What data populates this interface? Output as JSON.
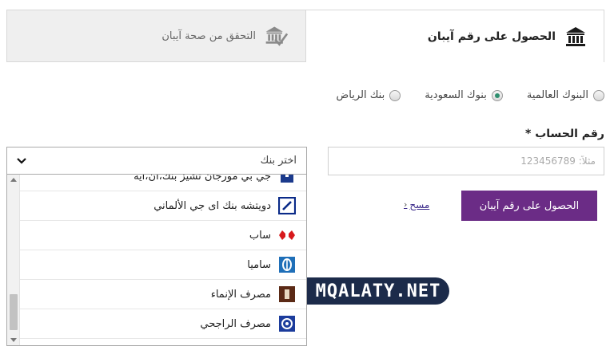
{
  "tabs": {
    "verify": {
      "label": "التحقق من صحة آيبان",
      "icon": "bank-check-icon"
    },
    "get": {
      "label": "الحصول على رقم آيبان",
      "icon": "bank-icon"
    }
  },
  "bank_groups": {
    "riyadh": "بنك الرياض",
    "saudi": "بنوك السعودية",
    "intl": "البنوك العالمية",
    "selected": "saudi"
  },
  "account": {
    "label": "رقم الحساب *",
    "placeholder": "مثلاً: 123456789",
    "value": ""
  },
  "actions": {
    "get_iban": "الحصول على رقم آيبان",
    "clear": "مسح",
    "clear_icon": "chevron-left-icon"
  },
  "bank_select": {
    "placeholder": "اختر بنك",
    "chevron_icon": "chevron-down-icon",
    "options": [
      {
        "name": "جي بي مورجان تشيز بنك،ان،ايه",
        "icon": "jpmorgan-logo"
      },
      {
        "name": "دويتشه بنك اى جي الألماني",
        "icon": "deutsche-bank-logo"
      },
      {
        "name": "ساب",
        "icon": "sabb-logo"
      },
      {
        "name": "ساميا",
        "icon": "samba-logo"
      },
      {
        "name": "مصرف الإنماء",
        "icon": "alinma-logo"
      },
      {
        "name": "مصرف الراجحي",
        "icon": "alrajhi-logo"
      }
    ]
  },
  "watermark": "MQALATY.NET",
  "colors": {
    "primary": "#6b2c86",
    "radio_checked": "#2f8f6f",
    "link": "#3b2a8a",
    "watermark_bg": "#1c2b4a"
  }
}
